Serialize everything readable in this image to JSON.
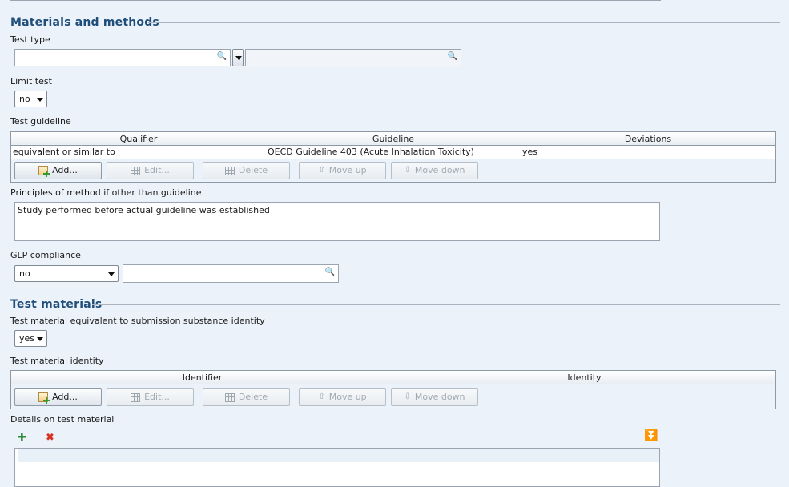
{
  "materials_methods": {
    "title": "Materials and methods",
    "test_type": {
      "label": "Test type",
      "value": "",
      "secondary_value": ""
    },
    "limit_test": {
      "label": "Limit test",
      "value": "no"
    },
    "test_guideline": {
      "label": "Test guideline",
      "columns": [
        "Qualifier",
        "Guideline",
        "Deviations"
      ],
      "rows": [
        {
          "qualifier": "equivalent or similar to",
          "guideline": "OECD Guideline 403 (Acute Inhalation Toxicity)",
          "deviations": "yes"
        }
      ],
      "buttons": {
        "add": "Add...",
        "edit": "Edit...",
        "delete": "Delete",
        "move_up": "Move up",
        "move_down": "Move down"
      }
    },
    "principles": {
      "label": "Principles of method if other than guideline",
      "value": "Study performed before actual guideline was established"
    },
    "glp": {
      "label": "GLP compliance",
      "value": "no",
      "remarks": ""
    }
  },
  "test_materials": {
    "title": "Test materials",
    "equivalent": {
      "label": "Test material equivalent to submission substance identity",
      "value": "yes"
    },
    "identity": {
      "label": "Test material identity",
      "columns": [
        "Identifier",
        "Identity"
      ],
      "buttons": {
        "add": "Add...",
        "edit": "Edit...",
        "delete": "Delete",
        "move_up": "Move up",
        "move_down": "Move down"
      }
    },
    "details": {
      "label": "Details on test material",
      "value": ""
    }
  },
  "icons": {
    "search": "magnifier-icon",
    "add": "add-row-icon",
    "edit": "edit-grid-icon",
    "delete": "delete-grid-icon",
    "move_up": "arrow-up-icon",
    "move_down": "arrow-down-icon",
    "insert_phrase": "insert-phrase-icon",
    "clear": "clear-x-icon",
    "expand": "double-chevron-down-icon"
  },
  "colors": {
    "section_title": "#1f4e79",
    "background": "#ebf2fa",
    "clear_icon": "#d9321e",
    "expand_icon": "#1e6fd0"
  }
}
